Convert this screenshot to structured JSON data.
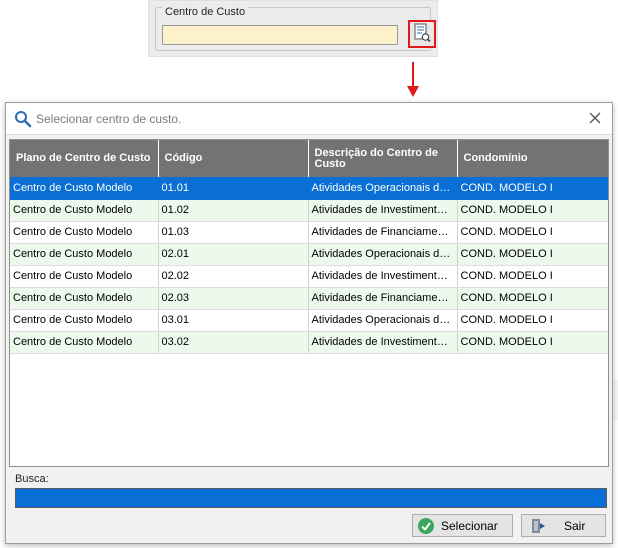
{
  "top_field": {
    "group_label": "Centro de Custo",
    "value": ""
  },
  "dialog": {
    "search_placeholder": "Selecionar centro de custo.",
    "columns": [
      "Plano de Centro de Custo",
      "Código",
      "Descrição do Centro de Custo",
      "Condomínio"
    ],
    "rows": [
      [
        "Centro de Custo Modelo",
        "01.01",
        "Atividades Operacionais de ...",
        "COND. MODELO I"
      ],
      [
        "Centro de Custo Modelo",
        "01.02",
        "Atividades de Investimentos...",
        "COND. MODELO I"
      ],
      [
        "Centro de Custo Modelo",
        "01.03",
        "Atividades de Financiament...",
        "COND. MODELO I"
      ],
      [
        "Centro de Custo Modelo",
        "02.01",
        "Atividades Operacionais de ...",
        "COND. MODELO I"
      ],
      [
        "Centro de Custo Modelo",
        "02.02",
        "Atividades de Investimentos...",
        "COND. MODELO I"
      ],
      [
        "Centro de Custo Modelo",
        "02.03",
        "Atividades de Financiament...",
        "COND. MODELO I"
      ],
      [
        "Centro de Custo Modelo",
        "03.01",
        "Atividades Operacionais de ...",
        "COND. MODELO I"
      ],
      [
        "Centro de Custo Modelo",
        "03.02",
        "Atividades de Investimentos...",
        "COND. MODELO I"
      ]
    ],
    "selected_row": 0,
    "busca_label": "Busca:",
    "busca_value": "",
    "buttons": {
      "select_label": "Selecionar",
      "exit_label": "Sair"
    }
  },
  "colors": {
    "selection": "#0a6fd4",
    "header": "#737373",
    "alt_row": "#ecf9ec",
    "highlight_border": "#e01818",
    "input_bg": "#fdf1c9"
  },
  "icons": [
    "lookup-list-icon",
    "search-icon",
    "close-icon",
    "check-circle-icon",
    "exit-door-icon",
    "down-arrow-icon"
  ]
}
